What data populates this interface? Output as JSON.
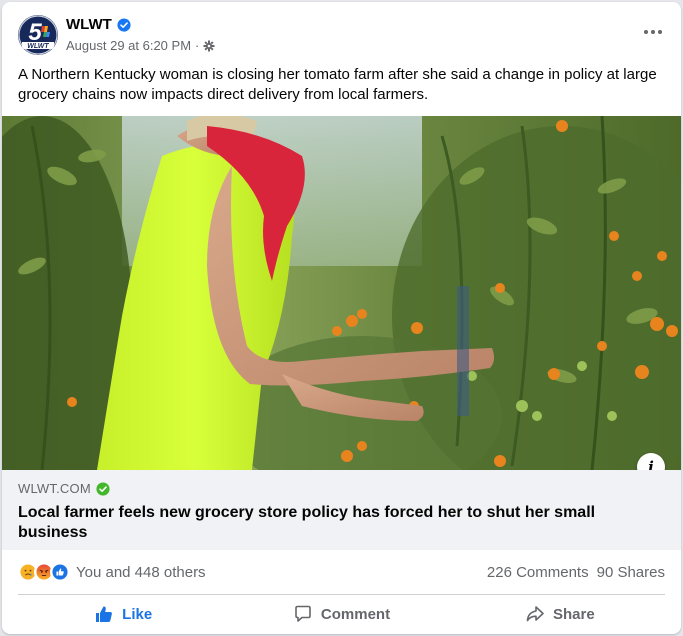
{
  "post": {
    "page_name": "WLWT",
    "timestamp": "August 29 at 6:20 PM",
    "separator": "·",
    "caption": "A Northern Kentucky woman is closing her tomato farm after she said a change in policy at large grocery chains now impacts direct delivery from local farmers."
  },
  "link": {
    "domain": "WLWT.COM",
    "title": "Local farmer feels new grocery store policy has forced her to shut her small business"
  },
  "stats": {
    "reactions_text": "You and 448 others",
    "comments": "226 Comments",
    "shares": "90 Shares",
    "reaction_icons": [
      "care-icon",
      "angry-icon",
      "like-icon"
    ]
  },
  "actions": {
    "like": "Like",
    "comment": "Comment",
    "share": "Share"
  },
  "colors": {
    "like_blue": "#1b74e4",
    "verified": "#1877f2",
    "domain_verified": "#42b72a",
    "link_bg": "#f0f2f5",
    "muted_text": "#65676b"
  },
  "logo": {
    "number": "5",
    "callsign": "WLWT"
  }
}
